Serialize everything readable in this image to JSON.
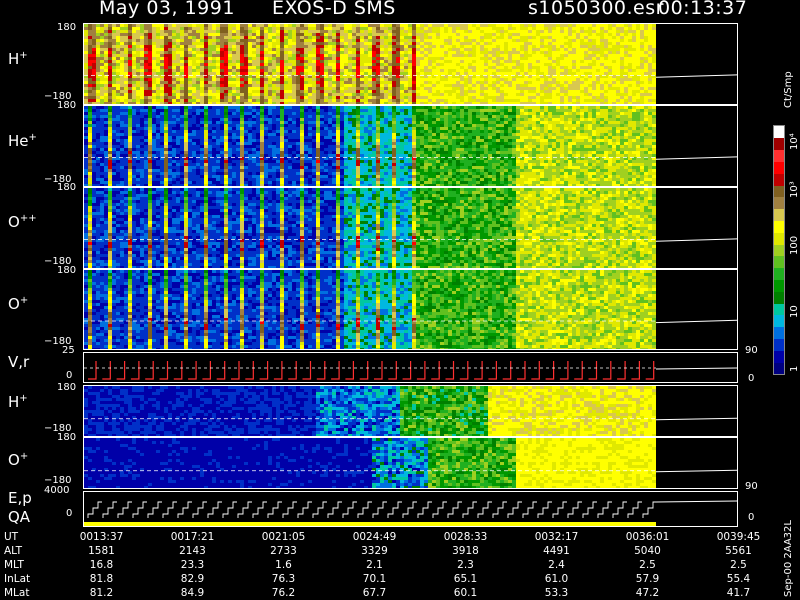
{
  "header": {
    "date": "May 03, 1991",
    "instrument": "EXOS-D SMS",
    "file": "s1050300.esr",
    "time": "00:13:37"
  },
  "colorbar": {
    "unit": "Ct/Smp",
    "ticks": [
      "1",
      "10",
      "100",
      "10³",
      "10⁴"
    ],
    "colors": [
      "#000080",
      "#0000a8",
      "#0030c8",
      "#0070e0",
      "#00b8e0",
      "#00c8a0",
      "#008000",
      "#009800",
      "#20b020",
      "#60c020",
      "#a0d020",
      "#e0e800",
      "#ffff00",
      "#d8c850",
      "#a08040",
      "#806020",
      "#c00000",
      "#ff0000",
      "#ff3030",
      "#a00000",
      "#ffffff"
    ]
  },
  "panels": [
    {
      "id": "h",
      "label": "H",
      "ion": "+",
      "top_tick": "180",
      "bot_tick": "−180"
    },
    {
      "id": "he",
      "label": "He",
      "ion": "+",
      "top_tick": "180",
      "bot_tick": "−180"
    },
    {
      "id": "opp",
      "label": "O",
      "ion": "++",
      "top_tick": "180",
      "bot_tick": "−180"
    },
    {
      "id": "o",
      "label": "O",
      "ion": "+",
      "top_tick": "180",
      "bot_tick": "−180"
    }
  ],
  "vr_panel": {
    "label": "V,r",
    "top_tick": "25",
    "bot_tick": "0",
    "right_top": "90",
    "right_bot": "0"
  },
  "low_panels": [
    {
      "id": "h2",
      "label": "H",
      "ion": "+",
      "top_tick": "180",
      "bot_tick": "−180"
    },
    {
      "id": "o2",
      "label": "O",
      "ion": "+",
      "top_tick": "180",
      "bot_tick": "−180"
    }
  ],
  "ep_panel": {
    "label": "E,p",
    "label2": "QA",
    "top_tick": "4000",
    "bot_tick": "0",
    "right_top": "90",
    "right_bot": "0"
  },
  "orbit": {
    "rows": [
      {
        "name": "UT",
        "values": [
          "0013:37",
          "0017:21",
          "0021:05",
          "0024:49",
          "0028:33",
          "0032:17",
          "0036:01",
          "0039:45"
        ]
      },
      {
        "name": "ALT",
        "values": [
          "1581",
          "2143",
          "2733",
          "3329",
          "3918",
          "4491",
          "5040",
          "5561"
        ]
      },
      {
        "name": "MLT",
        "values": [
          "16.8",
          "23.3",
          "1.6",
          "2.1",
          "2.3",
          "2.4",
          "2.5",
          "2.5"
        ]
      },
      {
        "name": "InLat",
        "values": [
          "81.8",
          "82.9",
          "76.3",
          "70.1",
          "65.1",
          "61.0",
          "57.9",
          "55.4"
        ]
      },
      {
        "name": "MLat",
        "values": [
          "81.2",
          "84.9",
          "76.2",
          "67.7",
          "60.1",
          "53.3",
          "47.2",
          "41.7"
        ]
      }
    ]
  },
  "footer": "Sep-00  2AA32L"
}
